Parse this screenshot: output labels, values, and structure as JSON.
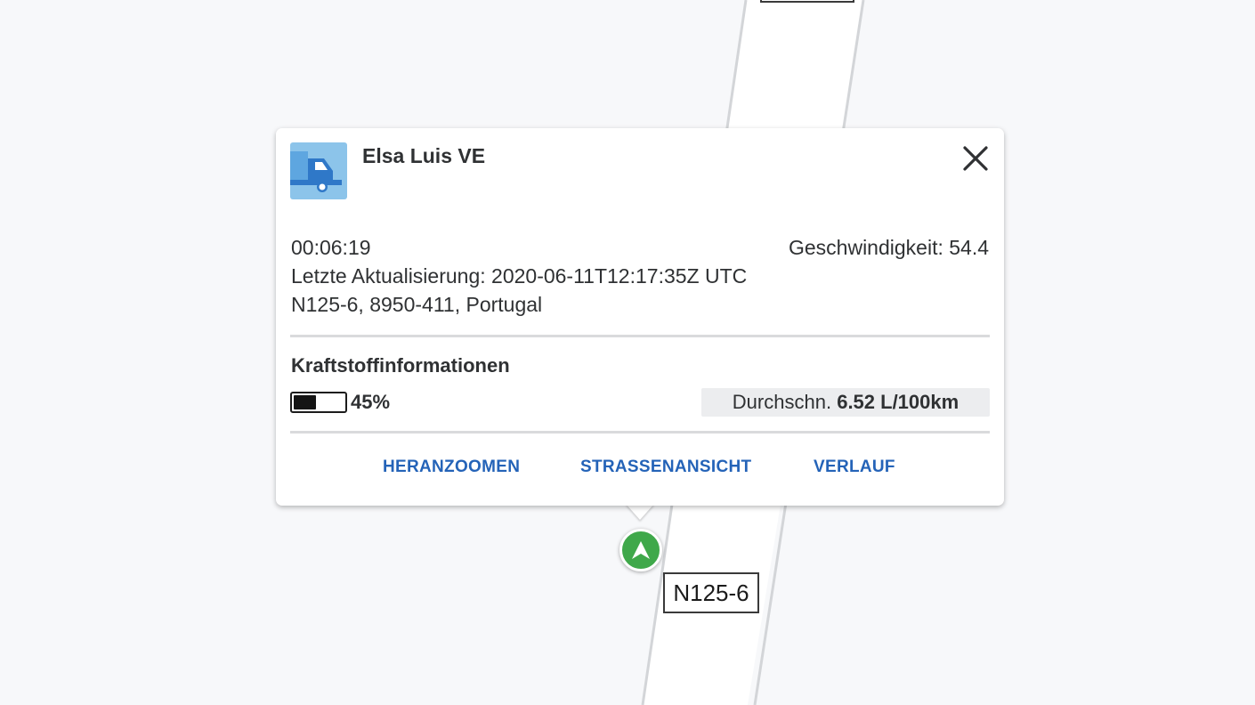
{
  "map": {
    "road_label": "N125-6"
  },
  "popup": {
    "vehicle_name": "Elsa Luis VE",
    "vehicle_icon": "truck-icon",
    "close_icon": "close-icon",
    "time": "00:06:19",
    "speed": "Geschwindigkeit: 54.4",
    "last_update": "Letzte Aktualisierung: 2020-06-11T12:17:35Z UTC",
    "address": "N125-6, 8950-411, Portugal",
    "fuel": {
      "title": "Kraftstoffinformationen",
      "level_fraction": 0.45,
      "percent_label": "45%",
      "avg_prefix": "Durchschn.",
      "avg_value": "6.52 L/100km"
    },
    "actions": {
      "zoom_label": "HERANZOOMEN",
      "streetview_label": "STRASSENANSICHT",
      "history_label": "VERLAUF"
    }
  },
  "colors": {
    "accent": "#2463b8",
    "marker": "#3fa84a",
    "avatar_bg": "#8cc4ea",
    "truck": "#2f78c8"
  }
}
